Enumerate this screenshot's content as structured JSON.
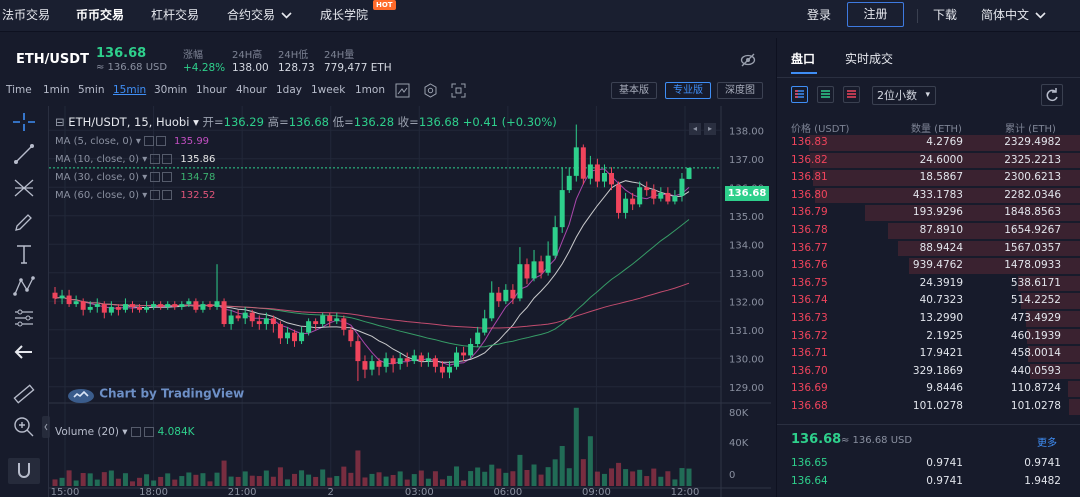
{
  "nav": {
    "fiat": "法币交易",
    "spot": "币币交易",
    "margin": "杠杆交易",
    "contract": "合约交易",
    "academy": "成长学院",
    "hot": "HOT",
    "login": "登录",
    "register": "注册",
    "download": "下载",
    "lang": "简体中文"
  },
  "header": {
    "symbol": "ETH/USDT",
    "last": "136.68",
    "last_sub": "≈ 136.68 USD",
    "change_label": "涨幅",
    "change": "+4.28%",
    "high_label": "24H高",
    "high": "138.00",
    "low_label": "24H低",
    "low": "128.73",
    "vol_label": "24H量",
    "vol": "779,477 ETH"
  },
  "timeframes": [
    "Time",
    "1min",
    "5min",
    "15min",
    "30min",
    "1hour",
    "4hour",
    "1day",
    "1week",
    "1mon"
  ],
  "active_tf": "15min",
  "views": {
    "basic": "基本版",
    "pro": "专业版",
    "depth": "深度图"
  },
  "legend": {
    "title": "ETH/USDT, 15, Huobi",
    "open_l": "开=",
    "open": "136.29",
    "high_l": "高=",
    "high": "136.68",
    "low_l": "低=",
    "low": "136.28",
    "close_l": "收=",
    "close": "136.68",
    "chg": "+0.41 (+0.30%)"
  },
  "ma": [
    {
      "label": "MA (5, close, 0)",
      "value": "135.99",
      "color": "#c24fc2"
    },
    {
      "label": "MA (10, close, 0)",
      "value": "135.86",
      "color": "#e8e8e8"
    },
    {
      "label": "MA (30, close, 0)",
      "value": "134.78",
      "color": "#3cb371"
    },
    {
      "label": "MA (60, close, 0)",
      "value": "132.52",
      "color": "#e0557a"
    }
  ],
  "watermark": "Chart by TradingView",
  "volume": {
    "label": "Volume (20)",
    "value": "4.084K"
  },
  "price_axis": [
    "138.00",
    "137.00",
    "136.00",
    "135.00",
    "134.00",
    "133.00",
    "132.00",
    "131.00",
    "130.00",
    "129.00"
  ],
  "vol_axis": [
    "80K",
    "40K",
    "0"
  ],
  "time_axis": [
    "15:00",
    "18:00",
    "21:00",
    "2",
    "03:00",
    "06:00",
    "09:00",
    "12:00"
  ],
  "price_tag": "136.68",
  "colors": {
    "up": "#2ed08c",
    "down": "#f0445c",
    "accent": "#3f8ef5"
  },
  "chart_data": {
    "type": "candlestick",
    "symbol": "ETH/USDT",
    "interval": "15",
    "ylim": [
      128.5,
      138.5
    ],
    "x_ticks": [
      "15:00",
      "18:00",
      "21:00",
      "2",
      "03:00",
      "06:00",
      "09:00",
      "12:00"
    ],
    "candles": [
      [
        132.3,
        132.1,
        132.5,
        131.9
      ],
      [
        132.1,
        132.2,
        132.4,
        131.9
      ],
      [
        132.2,
        131.9,
        132.4,
        131.8
      ],
      [
        131.9,
        132.0,
        132.2,
        131.8
      ],
      [
        132.0,
        131.7,
        132.1,
        131.5
      ],
      [
        131.7,
        131.8,
        132.0,
        131.6
      ],
      [
        131.8,
        131.9,
        132.1,
        131.6
      ],
      [
        131.9,
        131.6,
        132.0,
        131.4
      ],
      [
        131.6,
        131.8,
        132.0,
        131.5
      ],
      [
        131.8,
        131.7,
        131.9,
        131.5
      ],
      [
        131.7,
        131.9,
        132.1,
        131.6
      ],
      [
        131.9,
        131.8,
        132.0,
        131.6
      ],
      [
        131.8,
        131.7,
        131.9,
        131.6
      ],
      [
        131.7,
        131.8,
        132.0,
        131.6
      ],
      [
        131.8,
        131.9,
        132.0,
        131.7
      ],
      [
        131.9,
        131.8,
        132.0,
        131.7
      ],
      [
        131.8,
        131.9,
        132.0,
        131.7
      ],
      [
        131.9,
        131.8,
        132.0,
        131.7
      ],
      [
        131.8,
        131.9,
        132.0,
        131.7
      ],
      [
        131.9,
        132.0,
        132.1,
        131.8
      ],
      [
        132.0,
        131.7,
        132.1,
        131.6
      ],
      [
        131.7,
        131.9,
        132.0,
        131.6
      ],
      [
        131.9,
        131.8,
        132.0,
        131.7
      ],
      [
        131.8,
        132.0,
        133.3,
        131.7
      ],
      [
        132.0,
        131.2,
        132.1,
        131.1
      ],
      [
        131.2,
        131.5,
        131.7,
        131.0
      ],
      [
        131.5,
        131.4,
        131.7,
        131.3
      ],
      [
        131.4,
        131.6,
        131.8,
        131.2
      ],
      [
        131.6,
        131.3,
        131.7,
        131.1
      ],
      [
        131.3,
        131.2,
        131.5,
        131.0
      ],
      [
        131.2,
        131.4,
        131.6,
        131.0
      ],
      [
        131.4,
        131.2,
        131.5,
        130.9
      ],
      [
        131.2,
        130.7,
        131.3,
        130.5
      ],
      [
        130.7,
        130.9,
        131.1,
        130.5
      ],
      [
        130.9,
        130.6,
        131.0,
        130.4
      ],
      [
        130.6,
        130.9,
        131.1,
        130.5
      ],
      [
        130.9,
        131.3,
        131.4,
        130.8
      ],
      [
        131.3,
        131.2,
        131.4,
        131.0
      ],
      [
        131.2,
        131.5,
        131.6,
        131.1
      ],
      [
        131.5,
        131.3,
        131.6,
        131.1
      ],
      [
        131.3,
        131.4,
        131.6,
        131.2
      ],
      [
        131.4,
        131.0,
        131.5,
        130.8
      ],
      [
        131.0,
        130.6,
        131.1,
        130.4
      ],
      [
        130.6,
        129.9,
        130.8,
        129.2
      ],
      [
        129.9,
        129.6,
        130.1,
        129.3
      ],
      [
        129.6,
        129.9,
        130.1,
        129.4
      ],
      [
        129.9,
        129.7,
        130.0,
        129.4
      ],
      [
        129.7,
        130.0,
        130.2,
        129.5
      ],
      [
        130.0,
        129.8,
        130.1,
        129.5
      ],
      [
        129.8,
        130.0,
        130.2,
        129.6
      ],
      [
        130.0,
        129.9,
        130.2,
        129.7
      ],
      [
        129.9,
        130.1,
        130.3,
        129.8
      ],
      [
        130.1,
        129.9,
        130.2,
        129.7
      ],
      [
        129.9,
        130.0,
        130.2,
        129.7
      ],
      [
        130.0,
        129.7,
        130.1,
        129.5
      ],
      [
        129.7,
        129.5,
        129.9,
        129.3
      ],
      [
        129.5,
        129.7,
        129.9,
        129.3
      ],
      [
        129.7,
        130.2,
        130.4,
        129.6
      ],
      [
        130.2,
        130.1,
        130.4,
        129.9
      ],
      [
        130.1,
        130.5,
        130.7,
        130.0
      ],
      [
        130.5,
        130.9,
        131.1,
        130.4
      ],
      [
        130.9,
        131.4,
        131.7,
        130.8
      ],
      [
        131.4,
        132.3,
        132.7,
        131.3
      ],
      [
        132.3,
        132.0,
        132.5,
        131.8
      ],
      [
        132.0,
        132.4,
        132.6,
        131.9
      ],
      [
        132.4,
        132.1,
        132.6,
        131.9
      ],
      [
        132.1,
        133.3,
        133.9,
        132.0
      ],
      [
        133.3,
        132.8,
        133.5,
        132.6
      ],
      [
        132.8,
        133.4,
        133.8,
        132.7
      ],
      [
        133.4,
        133.0,
        133.6,
        132.8
      ],
      [
        133.0,
        133.6,
        134.1,
        132.9
      ],
      [
        133.6,
        134.6,
        135.0,
        133.5
      ],
      [
        134.6,
        135.9,
        136.7,
        134.4
      ],
      [
        135.9,
        136.4,
        136.7,
        135.8
      ],
      [
        136.4,
        137.4,
        138.2,
        136.2
      ],
      [
        137.4,
        136.3,
        137.5,
        136.1
      ],
      [
        136.3,
        136.8,
        137.1,
        136.1
      ],
      [
        136.8,
        136.2,
        137.0,
        136.0
      ],
      [
        136.2,
        136.5,
        136.8,
        136.0
      ],
      [
        136.5,
        136.1,
        136.7,
        135.9
      ],
      [
        136.1,
        135.1,
        136.2,
        134.9
      ],
      [
        135.1,
        135.6,
        135.8,
        134.9
      ],
      [
        135.6,
        135.4,
        135.8,
        135.2
      ],
      [
        135.4,
        136.0,
        136.2,
        135.3
      ],
      [
        136.0,
        135.9,
        136.2,
        135.7
      ],
      [
        135.9,
        135.6,
        136.1,
        135.4
      ],
      [
        135.6,
        135.8,
        136.0,
        135.5
      ],
      [
        135.8,
        135.5,
        136.0,
        135.4
      ],
      [
        135.5,
        135.7,
        135.9,
        135.4
      ],
      [
        135.7,
        136.3,
        136.5,
        135.5
      ],
      [
        136.29,
        136.68,
        136.68,
        136.28
      ]
    ]
  },
  "orderbook": {
    "tab_book": "盘口",
    "tab_trades": "实时成交",
    "decimals": "2位小数",
    "col_price": "价格 (USDT)",
    "col_qty": "数量 (ETH)",
    "col_total": "累计 (ETH)",
    "more": "更多",
    "mid": "136.68",
    "mid_sub": "≈ 136.68 USD",
    "asks": [
      [
        "136.83",
        "4.2769",
        "2329.4982"
      ],
      [
        "136.82",
        "24.6000",
        "2325.2213"
      ],
      [
        "136.81",
        "18.5867",
        "2300.6213"
      ],
      [
        "136.80",
        "433.1783",
        "2282.0346"
      ],
      [
        "136.79",
        "193.9296",
        "1848.8563"
      ],
      [
        "136.78",
        "87.8910",
        "1654.9267"
      ],
      [
        "136.77",
        "88.9424",
        "1567.0357"
      ],
      [
        "136.76",
        "939.4762",
        "1478.0933"
      ],
      [
        "136.75",
        "24.3919",
        "538.6171"
      ],
      [
        "136.74",
        "40.7323",
        "514.2252"
      ],
      [
        "136.73",
        "13.2990",
        "473.4929"
      ],
      [
        "136.72",
        "2.1925",
        "460.1939"
      ],
      [
        "136.71",
        "17.9421",
        "458.0014"
      ],
      [
        "136.70",
        "329.1869",
        "440.0593"
      ],
      [
        "136.69",
        "9.8446",
        "110.8724"
      ],
      [
        "136.68",
        "101.0278",
        "101.0278"
      ]
    ],
    "bids": [
      [
        "136.65",
        "0.9741",
        "0.9741"
      ],
      [
        "136.64",
        "0.9741",
        "1.9482"
      ]
    ]
  }
}
